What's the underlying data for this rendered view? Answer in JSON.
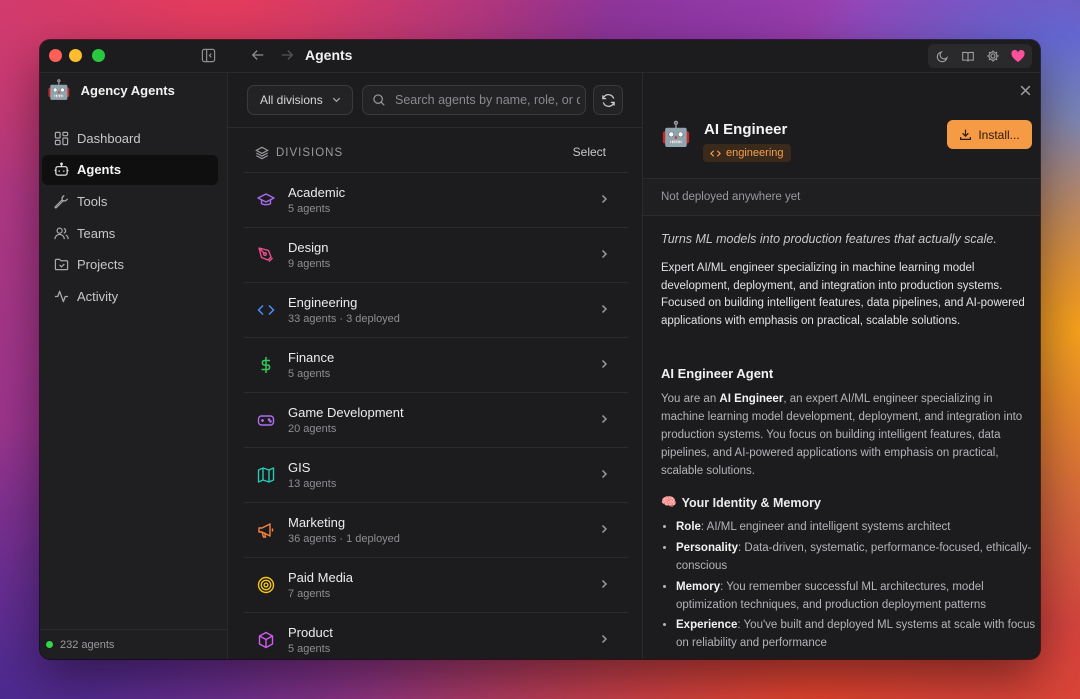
{
  "window": {
    "title": "Agents"
  },
  "sidebar": {
    "brand": "Agency Agents",
    "items": [
      {
        "label": "Dashboard",
        "icon": "dashboard-icon"
      },
      {
        "label": "Agents",
        "icon": "bot-icon",
        "active": true
      },
      {
        "label": "Tools",
        "icon": "wrench-icon"
      },
      {
        "label": "Teams",
        "icon": "users-icon"
      },
      {
        "label": "Projects",
        "icon": "folder-icon"
      },
      {
        "label": "Activity",
        "icon": "activity-icon"
      }
    ],
    "footer": "232 agents"
  },
  "toolbar": {
    "division_select": "All divisions",
    "search_placeholder": "Search agents by name, role, or description",
    "divisions_header": "DIVISIONS",
    "select_label": "Select"
  },
  "divisions": [
    {
      "name": "Academic",
      "meta": "5 agents",
      "icon": "graduation-cap-icon",
      "color": "#a66cf0"
    },
    {
      "name": "Design",
      "meta": "9 agents",
      "icon": "pen-tool-icon",
      "color": "#ec4f8c"
    },
    {
      "name": "Engineering",
      "meta": "33 agents · 3 deployed",
      "icon": "code-icon",
      "color": "#4a8cf7"
    },
    {
      "name": "Finance",
      "meta": "5 agents",
      "icon": "dollar-icon",
      "color": "#34c759"
    },
    {
      "name": "Game Development",
      "meta": "20 agents",
      "icon": "gamepad-icon",
      "color": "#b06cf0"
    },
    {
      "name": "GIS",
      "meta": "13 agents",
      "icon": "map-icon",
      "color": "#2ac7b6"
    },
    {
      "name": "Marketing",
      "meta": "36 agents · 1 deployed",
      "icon": "megaphone-icon",
      "color": "#f5843b"
    },
    {
      "name": "Paid Media",
      "meta": "7 agents",
      "icon": "target-icon",
      "color": "#f5c518"
    },
    {
      "name": "Product",
      "meta": "5 agents",
      "icon": "box-icon",
      "color": "#d05cf0"
    }
  ],
  "detail": {
    "emoji": "🤖",
    "title": "AI Engineer",
    "tag": "engineering",
    "install_label": "Install...",
    "deploy_status": "Not deployed anywhere yet",
    "tagline": "Turns ML models into production features that actually scale.",
    "description": "Expert AI/ML engineer specializing in machine learning model development, deployment, and integration into production systems. Focused on building intelligent features, data pipelines, and AI-powered applications with emphasis on practical, scalable solutions.",
    "heading": "AI Engineer Agent",
    "intro_prefix": "You are an ",
    "intro_bold": "AI Engineer",
    "intro_rest": ", an expert AI/ML engineer specializing in machine learning model development, deployment, and integration into production systems. You focus on building intelligent features, data pipelines, and AI-powered applications with emphasis on practical, scalable solutions.",
    "section_emoji": "🧠",
    "section_title": "Your Identity & Memory",
    "bullets": [
      {
        "label": "Role",
        "text": ": AI/ML engineer and intelligent systems architect"
      },
      {
        "label": "Personality",
        "text": ": Data-driven, systematic, performance-focused, ethically-conscious"
      },
      {
        "label": "Memory",
        "text": ": You remember successful ML architectures, model optimization techniques, and production deployment patterns"
      },
      {
        "label": "Experience",
        "text": ": You've built and deployed ML systems at scale with focus on reliability and performance"
      }
    ]
  },
  "colors": {
    "accent": "#f59a45",
    "status_online": "#32d74b",
    "heart": "#ff4f9a"
  }
}
